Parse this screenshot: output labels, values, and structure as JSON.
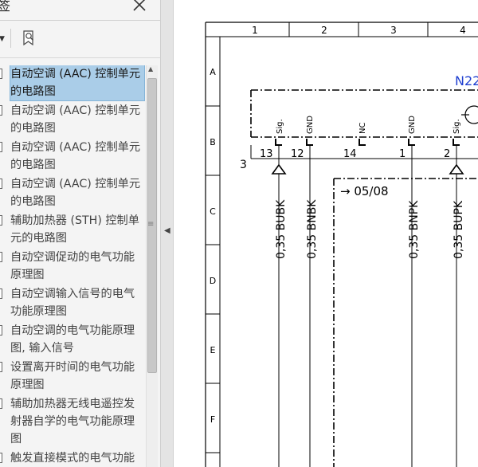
{
  "panel": {
    "title": "签",
    "bookmarks": [
      {
        "label": "自动空调 (AAC) 控制单元的电路图",
        "selected": true
      },
      {
        "label": "自动空调 (AAC) 控制单元的电路图",
        "selected": false
      },
      {
        "label": "自动空调 (AAC) 控制单元的电路图",
        "selected": false
      },
      {
        "label": "自动空调 (AAC) 控制单元的电路图",
        "selected": false
      },
      {
        "label": "辅助加热器 (STH) 控制单元的电路图",
        "selected": false
      },
      {
        "label": "自动空调促动的电气功能原理图",
        "selected": false
      },
      {
        "label": "自动空调输入信号的电气功能原理图",
        "selected": false
      },
      {
        "label": "自动空调的电气功能原理图, 输入信号",
        "selected": false
      },
      {
        "label": "设置离开时间的电气功能原理图",
        "selected": false
      },
      {
        "label": "辅助加热器无线电遥控发射器自学的电气功能原理图",
        "selected": false
      },
      {
        "label": "触发直接模式的电气功能",
        "selected": false
      }
    ]
  },
  "schematic": {
    "columns": [
      "1",
      "2",
      "3",
      "4"
    ],
    "rows": [
      "A",
      "B",
      "C",
      "D",
      "E",
      "F"
    ],
    "component": "N22",
    "pins": [
      {
        "signal": "Sig.",
        "number": "13",
        "wire": "0,35 BUBK"
      },
      {
        "signal": "GND",
        "number": "12",
        "wire": "0,35 BNBK"
      },
      {
        "signal": "NC",
        "number": "14",
        "wire": ""
      },
      {
        "signal": "GND",
        "number": "1",
        "wire": "0,35 BNPK"
      },
      {
        "signal": "Sig.",
        "number": "2",
        "wire": "0,35 BUPK"
      }
    ],
    "connector_label": "3",
    "reference": "→ 05/08"
  }
}
